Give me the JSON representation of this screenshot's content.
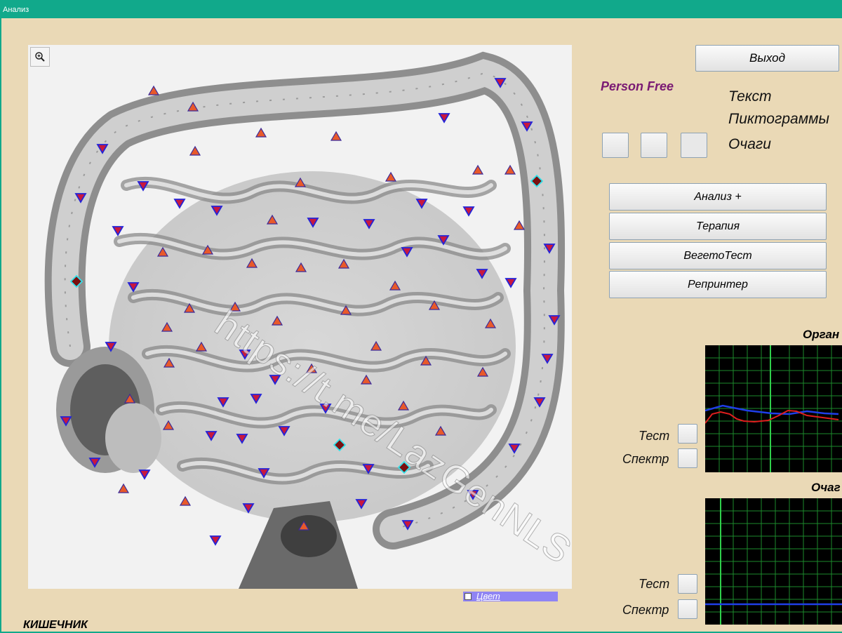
{
  "window": {
    "title": "Анализ"
  },
  "buttons": {
    "exit": "Выход",
    "analysis": "Анализ +",
    "therapy": "Терапия",
    "vegetest": "ВегетоТест",
    "reprinter": "Репринтер"
  },
  "person": {
    "label": "Person Free"
  },
  "display_options": {
    "text": "Текст",
    "pictograms": "Пиктограммы",
    "foci": "Очаги"
  },
  "image": {
    "organ_name": "КИШЕЧНИК",
    "watermark": "https://t.me/LazGenNLS",
    "color_toggle": {
      "label": "Цвет",
      "checked": false
    }
  },
  "organ_panel": {
    "title": "Орган",
    "test_label": "Тест",
    "spectrum_label": "Спектр"
  },
  "foci_panel": {
    "title": "Очаг",
    "test_label": "Тест",
    "spectrum_label": "Спектр"
  },
  "colors": {
    "titlebar": "#11a98b",
    "background": "#ead9b6",
    "person_label": "#7a1a73",
    "marker_up": "#e8592a",
    "marker_down": "#c8183e",
    "marker_focus": "#7a1010",
    "graph_blue": "#1f3ee8",
    "graph_red": "#e01e1e",
    "grid": "#1c8a2c"
  },
  "icons": {
    "zoom": "magnifier-plus-icon"
  }
}
